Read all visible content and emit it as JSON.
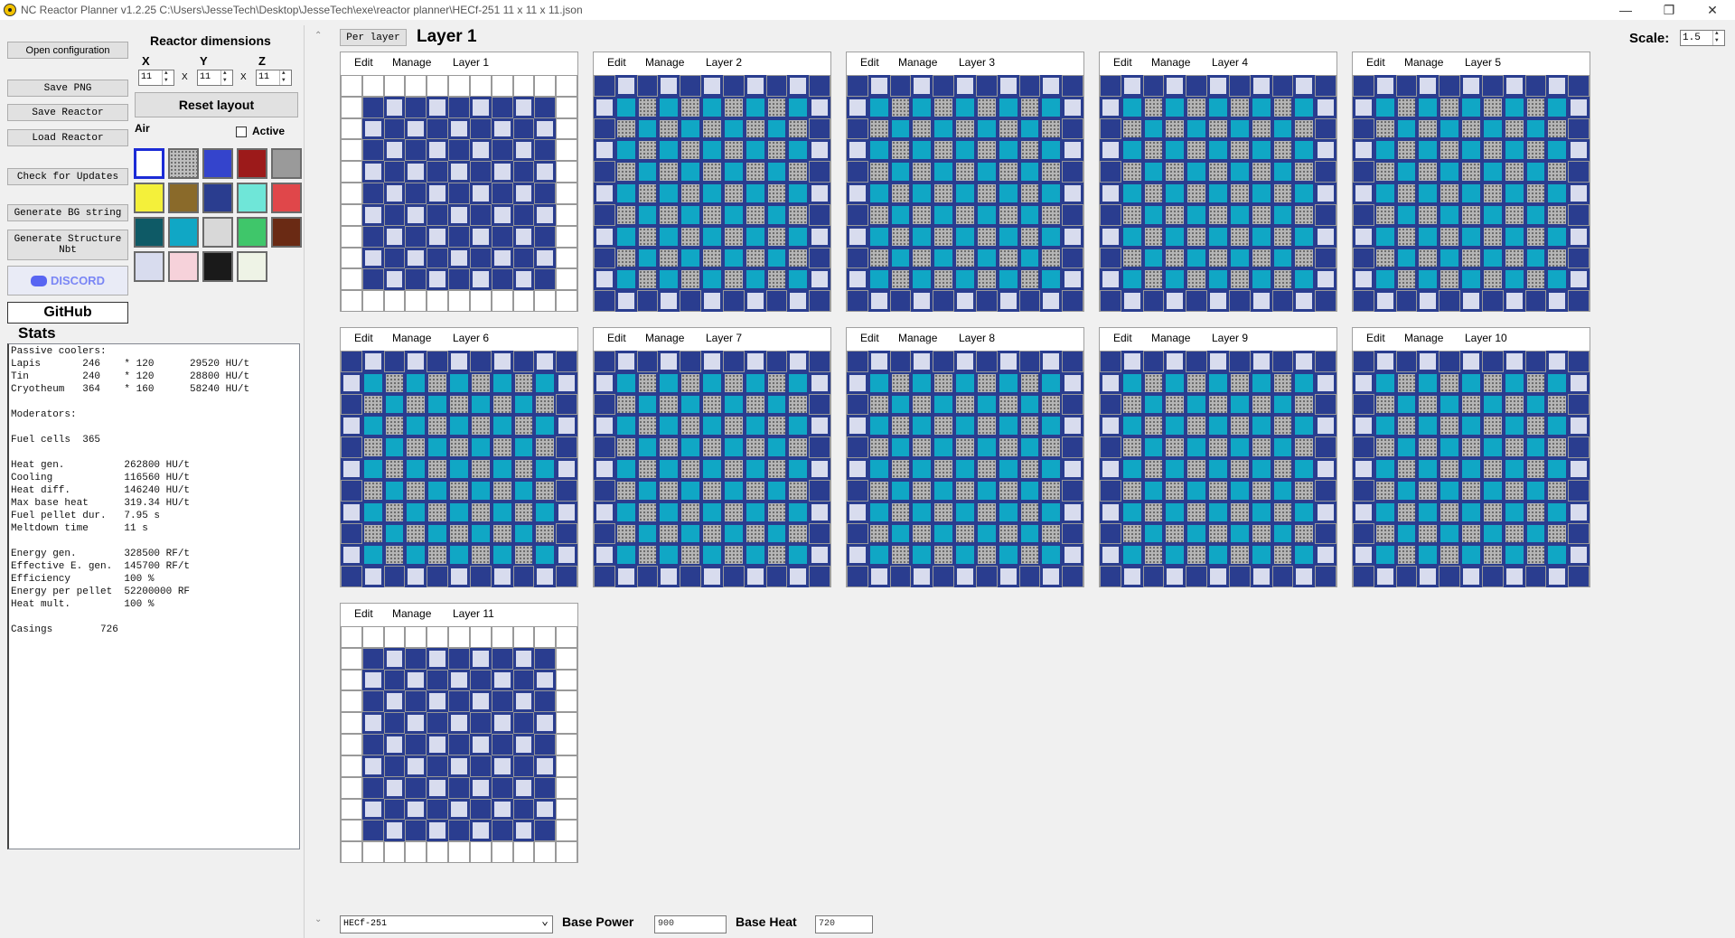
{
  "window": {
    "title": "NC Reactor Planner v1.2.25    C:\\Users\\JesseTech\\Desktop\\JesseTech\\exe\\reactor planner\\HECf-251 11 x 11 x 11.json",
    "minimize": "—",
    "restore": "❐",
    "close": "✕"
  },
  "sidebar": {
    "open_config": "Open configuration",
    "save_png": "Save PNG",
    "save_reactor": "Save Reactor",
    "load_reactor": "Load Reactor",
    "check_updates": "Check for Updates",
    "gen_bg": "Generate BG string",
    "gen_nbt": "Generate Structure Nbt",
    "discord": "DISCORD",
    "github": "GitHub"
  },
  "dimensions": {
    "title": "Reactor dimensions",
    "x_label": "X",
    "y_label": "Y",
    "z_label": "Z",
    "x": "11",
    "y": "11",
    "z": "11",
    "sep": "X",
    "reset": "Reset layout"
  },
  "palette": {
    "selected_name": "Air",
    "active_label": "Active",
    "blocks": [
      {
        "name": "air",
        "color": "#ffffff"
      },
      {
        "name": "fuel-cell",
        "color": "#bdbdbd"
      },
      {
        "name": "water-cooler",
        "color": "#3444cc"
      },
      {
        "name": "redstone-cooler",
        "color": "#9c1a1a"
      },
      {
        "name": "quartz-cooler",
        "color": "#9a9a9a"
      },
      {
        "name": "glowstone-cooler",
        "color": "#f4f03a"
      },
      {
        "name": "gold-cooler",
        "color": "#8a6a2a"
      },
      {
        "name": "lapis-cooler",
        "color": "#2a3d8f"
      },
      {
        "name": "diamond-cooler",
        "color": "#6fe6d8"
      },
      {
        "name": "helium-cooler",
        "color": "#e0474a"
      },
      {
        "name": "enderium-cooler",
        "color": "#0e5a66"
      },
      {
        "name": "cryotheum-cooler",
        "color": "#10a7c5"
      },
      {
        "name": "iron-cooler",
        "color": "#d8d8d8"
      },
      {
        "name": "emerald-cooler",
        "color": "#3fc66a"
      },
      {
        "name": "copper-cooler",
        "color": "#6a2a14"
      },
      {
        "name": "tin-cooler",
        "color": "#d8dcee"
      },
      {
        "name": "magnesium-cooler",
        "color": "#f6d2da"
      },
      {
        "name": "graphite-moderator",
        "color": "#1a1a1a"
      },
      {
        "name": "beryllium-moderator",
        "color": "#eef3e6"
      }
    ]
  },
  "stats": {
    "title": "Stats",
    "lines": [
      "Passive coolers:",
      "Lapis       246    * 120      29520 HU/t",
      "Tin         240    * 120      28800 HU/t",
      "Cryotheum   364    * 160      58240 HU/t",
      "",
      "Moderators:",
      "",
      "Fuel cells  365",
      "",
      "Heat gen.          262800 HU/t",
      "Cooling            116560 HU/t",
      "Heat diff.         146240 HU/t",
      "Max base heat      319.34 HU/t",
      "Fuel pellet dur.   7.95 s",
      "Meltdown time      11 s",
      "",
      "Energy gen.        328500 RF/t",
      "Effective E. gen.  145700 RF/t",
      "Efficiency         100 %",
      "Energy per pellet  52200000 RF",
      "Heat mult.         100 %",
      "",
      "Casings        726"
    ]
  },
  "view": {
    "mode_button": "Per layer",
    "current_layer": "Layer 1",
    "scale_label": "Scale:",
    "scale_value": "1.5"
  },
  "layer_tabs": {
    "edit": "Edit",
    "manage": "Manage"
  },
  "layers": [
    {
      "label": "Layer 1",
      "pattern": "outer"
    },
    {
      "label": "Layer 2",
      "pattern": "inner"
    },
    {
      "label": "Layer 3",
      "pattern": "inner"
    },
    {
      "label": "Layer 4",
      "pattern": "inner"
    },
    {
      "label": "Layer 5",
      "pattern": "inner"
    },
    {
      "label": "Layer 6",
      "pattern": "inner"
    },
    {
      "label": "Layer 7",
      "pattern": "inner"
    },
    {
      "label": "Layer 8",
      "pattern": "inner"
    },
    {
      "label": "Layer 9",
      "pattern": "inner"
    },
    {
      "label": "Layer 10",
      "pattern": "inner"
    },
    {
      "label": "Layer 11",
      "pattern": "outer"
    }
  ],
  "bottom": {
    "fuel": "HECf-251",
    "base_power_label": "Base Power",
    "base_power": "900",
    "base_heat_label": "Base Heat",
    "base_heat": "720"
  }
}
